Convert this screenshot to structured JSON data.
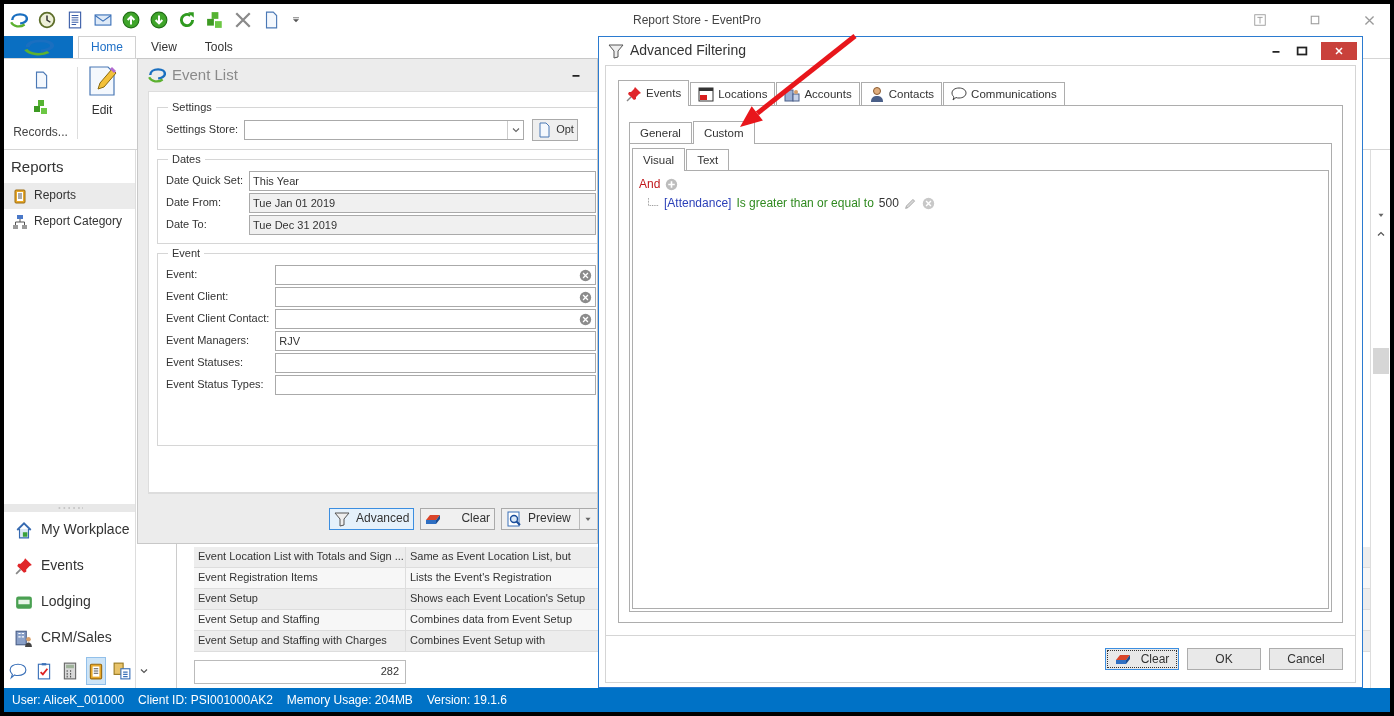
{
  "window": {
    "title": "Report Store - EventPro"
  },
  "ribbon": {
    "tabs": [
      {
        "label": "Home",
        "selected": true
      },
      {
        "label": "View",
        "selected": false
      },
      {
        "label": "Tools",
        "selected": false
      }
    ],
    "group_label": "Records...",
    "edit_button": "Edit"
  },
  "sidebar": {
    "header": "Reports",
    "items": [
      {
        "label": "Reports",
        "selected": true
      },
      {
        "label": "Report Category",
        "selected": false
      }
    ],
    "nav": [
      {
        "label": "My Workplace"
      },
      {
        "label": "Events"
      },
      {
        "label": "Lodging"
      },
      {
        "label": "CRM/Sales"
      }
    ],
    "shortcuts": [
      {
        "selected": false
      },
      {
        "selected": false
      },
      {
        "selected": false
      },
      {
        "selected": true
      },
      {
        "selected": false
      }
    ]
  },
  "report_table": {
    "rows": [
      {
        "name": "Event Location List with Totals and Sign ...",
        "description": "Same as Event Location List, but"
      },
      {
        "name": "Event Registration Items",
        "description": "Lists the Event's Registration"
      },
      {
        "name": "Event Setup",
        "description": "Shows each Event Location's Setup"
      },
      {
        "name": "Event Setup and Staffing",
        "description": "Combines data from Event Setup"
      },
      {
        "name": "Event Setup and Staffing with Charges",
        "description": "Combines Event Setup with"
      }
    ],
    "count": "282"
  },
  "event_list": {
    "title": "Event List",
    "sections": [
      {
        "legend": "Settings",
        "fields": [
          {
            "label": "Settings Store:",
            "kind": "combo",
            "button": "Opt"
          }
        ]
      },
      {
        "legend": "Dates",
        "fields": [
          {
            "label": "Date Quick Set:",
            "kind": "text",
            "value": "This Year"
          },
          {
            "label": "Date From:",
            "kind": "readonly",
            "value": "Tue Jan 01 2019"
          },
          {
            "label": "Date To:",
            "kind": "readonly",
            "value": "Tue Dec 31 2019"
          }
        ]
      },
      {
        "legend": "Event",
        "fields": [
          {
            "label": "Event:",
            "kind": "clearable"
          },
          {
            "label": "Event Client:",
            "kind": "clearable"
          },
          {
            "label": "Event Client Contact:",
            "kind": "clearable"
          },
          {
            "label": "Event Managers:",
            "kind": "text",
            "value": "RJV"
          },
          {
            "label": "Event Statuses:",
            "kind": "text"
          },
          {
            "label": "Event Status Types:",
            "kind": "text"
          }
        ]
      }
    ],
    "buttons": [
      {
        "label": "Advanced",
        "kind": "filter",
        "focused": true
      },
      {
        "label": "Clear",
        "kind": "eraser",
        "focused": false
      },
      {
        "label": "Preview",
        "kind": "split",
        "focused": false
      }
    ]
  },
  "dialog": {
    "title": "Advanced Filtering",
    "tabs": [
      {
        "label": "Events",
        "selected": true
      },
      {
        "label": "Locations",
        "selected": false
      },
      {
        "label": "Accounts",
        "selected": false
      },
      {
        "label": "Contacts",
        "selected": false
      },
      {
        "label": "Communications",
        "selected": false
      }
    ],
    "subtabs": [
      {
        "label": "General",
        "selected": false
      },
      {
        "label": "Custom",
        "selected": true
      }
    ],
    "view_tabs": [
      {
        "label": "Visual",
        "selected": true
      },
      {
        "label": "Text",
        "selected": false
      }
    ],
    "filter": {
      "operator": "And",
      "conditions": [
        {
          "field": "[Attendance]",
          "operation": "Is greater than or equal to",
          "value": "500"
        }
      ]
    },
    "buttons": [
      {
        "label": "Clear",
        "kind": "eraser",
        "focused": true
      },
      {
        "label": "OK",
        "kind": "plain",
        "focused": false
      },
      {
        "label": "Cancel",
        "kind": "plain",
        "focused": false
      }
    ]
  },
  "status_bar": [
    "User: AliceK_001000",
    "Client ID: PSI001000AK2",
    "Memory Usage: 204MB",
    "Version: 19.1.6"
  ]
}
